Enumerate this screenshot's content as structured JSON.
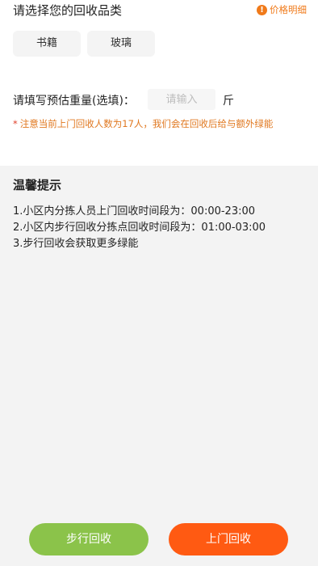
{
  "header": {
    "title": "请选择您的回收品类",
    "price_detail_label": "价格明细",
    "price_icon": "!"
  },
  "categories": [
    {
      "label": "书籍"
    },
    {
      "label": "玻璃"
    }
  ],
  "weight": {
    "label": "请填写预估重量(选填)：",
    "placeholder": "请输入",
    "value": "",
    "unit": "斤"
  },
  "notice": {
    "star": "*",
    "text": "注意当前上门回收人数为17人，我们会在回收后给与额外绿能"
  },
  "tips": {
    "title": "温馨提示",
    "items": [
      "1.小区内分拣人员上门回收时间段为：00:00-23:00",
      "2.小区内步行回收分拣点回收时间段为：01:00-03:00",
      "3.步行回收会获取更多绿能"
    ]
  },
  "actions": {
    "walk_label": "步行回收",
    "door_label": "上门回收"
  },
  "colors": {
    "accent_orange": "#ff5a12",
    "notice_orange": "#e07820",
    "walk_green": "#8bc34a"
  }
}
